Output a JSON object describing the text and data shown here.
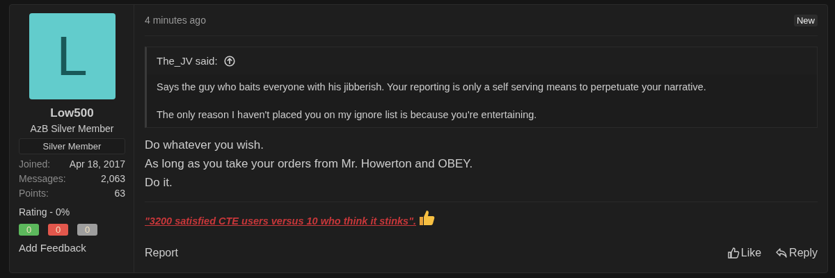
{
  "user": {
    "avatar_letter": "L",
    "name": "Low500",
    "title": "AzB Silver Member",
    "banner": "Silver Member",
    "stats": [
      {
        "label": "Joined:",
        "value": "Apr 18, 2017"
      },
      {
        "label": "Messages:",
        "value": "2,063"
      },
      {
        "label": "Points:",
        "value": "63"
      }
    ],
    "rating": "Rating - 0%",
    "feedback": [
      {
        "count": "0",
        "color": "#5cb85c"
      },
      {
        "count": "0",
        "color": "#e2574c"
      },
      {
        "count": "0",
        "color": "#9e9e9e"
      }
    ],
    "add_feedback": "Add Feedback"
  },
  "post": {
    "time": "4 minutes ago",
    "badge": "New",
    "quote": {
      "author": "The_JV said:",
      "paragraphs": [
        "Says the guy who baits everyone with his jibberish. Your reporting is only a self serving means to perpetuate your narrative.",
        "The only reason I haven't placed you on my ignore list is because you're entertaining."
      ]
    },
    "lines": [
      "Do whatever you wish.",
      "As long as you take your orders from Mr. Howerton and OBEY.",
      "Do it."
    ],
    "signature": "\"3200 satisfied CTE users versus 10 who think it stinks\".",
    "actions_left": [
      "Report"
    ],
    "actions_right": [
      {
        "kind": "like",
        "label": "Like"
      },
      {
        "kind": "reply",
        "label": "Reply"
      }
    ]
  }
}
